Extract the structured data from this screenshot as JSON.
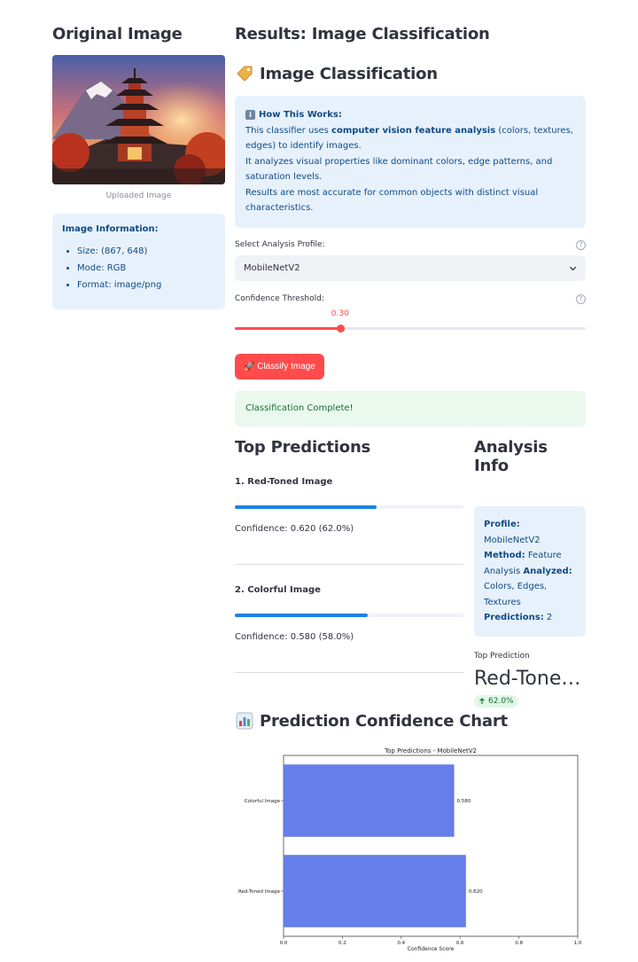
{
  "left": {
    "title": "Original Image",
    "caption": "Uploaded Image",
    "info": {
      "heading": "Image Information:",
      "items": [
        "Size: (867, 648)",
        "Mode: RGB",
        "Format: image/png"
      ]
    }
  },
  "right": {
    "title": "Results: Image Classification",
    "classification_heading": "Image Classification",
    "how": {
      "heading": "How This Works:",
      "line1_pre": "This classifier uses ",
      "line1_bold": "computer vision feature analysis",
      "line1_post": " (colors, textures, edges) to identify images.",
      "line2": "It analyzes visual properties like dominant colors, edge patterns, and saturation levels.",
      "line3": "Results are most accurate for common objects with distinct visual characteristics."
    },
    "profile": {
      "label": "Select Analysis Profile:",
      "value": "MobileNetV2"
    },
    "threshold": {
      "label": "Confidence Threshold:",
      "value_text": "0.30",
      "value": 0.3,
      "min": 0,
      "max": 1
    },
    "classify_button": "🚀 Classify Image",
    "success": "Classification Complete!"
  },
  "predictions": {
    "title": "Top Predictions",
    "items": [
      {
        "name": "1. Red-Toned Image",
        "confidence": 0.62,
        "text": "Confidence: 0.620 (62.0%)"
      },
      {
        "name": "2. Colorful Image",
        "confidence": 0.58,
        "text": "Confidence: 0.580 (58.0%)"
      }
    ]
  },
  "analysis": {
    "title": "Analysis Info",
    "profile_label": "Profile:",
    "profile_value": " MobileNetV2",
    "method_label": "Method:",
    "method_value": " Feature Analysis ",
    "analyzed_label": "Analyzed:",
    "analyzed_value": " Colors, Edges, Textures",
    "predictions_label": "Predictions:",
    "predictions_value": " 2",
    "metric_label": "Top Prediction",
    "metric_value": "Red-Toned Image",
    "metric_delta": "62.0%"
  },
  "chart_section_title": "Prediction Confidence Chart",
  "chart_data": {
    "type": "bar",
    "orientation": "horizontal",
    "title": "Top Predictions - MobileNetV2",
    "xlabel": "Confidence Score",
    "ylabel": "",
    "categories": [
      "Colorful Image",
      "Red-Toned Image"
    ],
    "values": [
      0.58,
      0.62
    ],
    "value_labels": [
      "0.580",
      "0.620"
    ],
    "xlim": [
      0,
      1
    ],
    "xticks": [
      "0.0",
      "0.2",
      "0.4",
      "0.6",
      "0.8",
      "1.0"
    ],
    "bar_color": "#667eea",
    "grid": false
  },
  "colors": {
    "accent": "#ff4b4b",
    "info_bg": "#e7f1fc",
    "info_text": "#0e4b87",
    "progress": "#1c83e1",
    "success_bg": "#eaf8ee",
    "success_text": "#177233"
  }
}
